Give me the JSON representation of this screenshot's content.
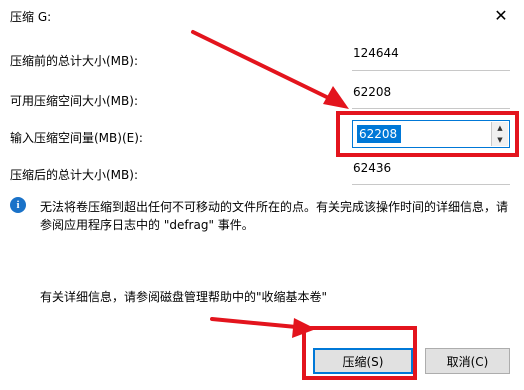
{
  "dialog": {
    "title": "压缩 G:",
    "close_glyph": "✕"
  },
  "fields": {
    "total_before_label": "压缩前的总计大小(MB):",
    "total_before_value": "124644",
    "available_label": "可用压缩空间大小(MB):",
    "available_value": "62208",
    "input_label": "输入压缩空间量(MB)(E):",
    "input_value": "62208",
    "total_after_label": "压缩后的总计大小(MB):",
    "total_after_value": "62436"
  },
  "info": {
    "icon": "i",
    "text": "无法将卷压缩到超出任何不可移动的文件所在的点。有关完成该操作时间的详细信息，请参阅应用程序日志中的 \"defrag\" 事件。"
  },
  "help": {
    "text": "有关详细信息，请参阅磁盘管理帮助中的\"收缩基本卷\""
  },
  "buttons": {
    "shrink_label": "压缩(S)",
    "cancel_label": "取消(C)"
  },
  "icons": {
    "info": "info-icon",
    "close": "close-icon",
    "spin_up": "chevron-up-icon",
    "spin_down": "chevron-down-icon"
  },
  "colors": {
    "annotation_red": "#e3141d",
    "accent": "#0078d7",
    "info_blue": "#1a72c8"
  }
}
